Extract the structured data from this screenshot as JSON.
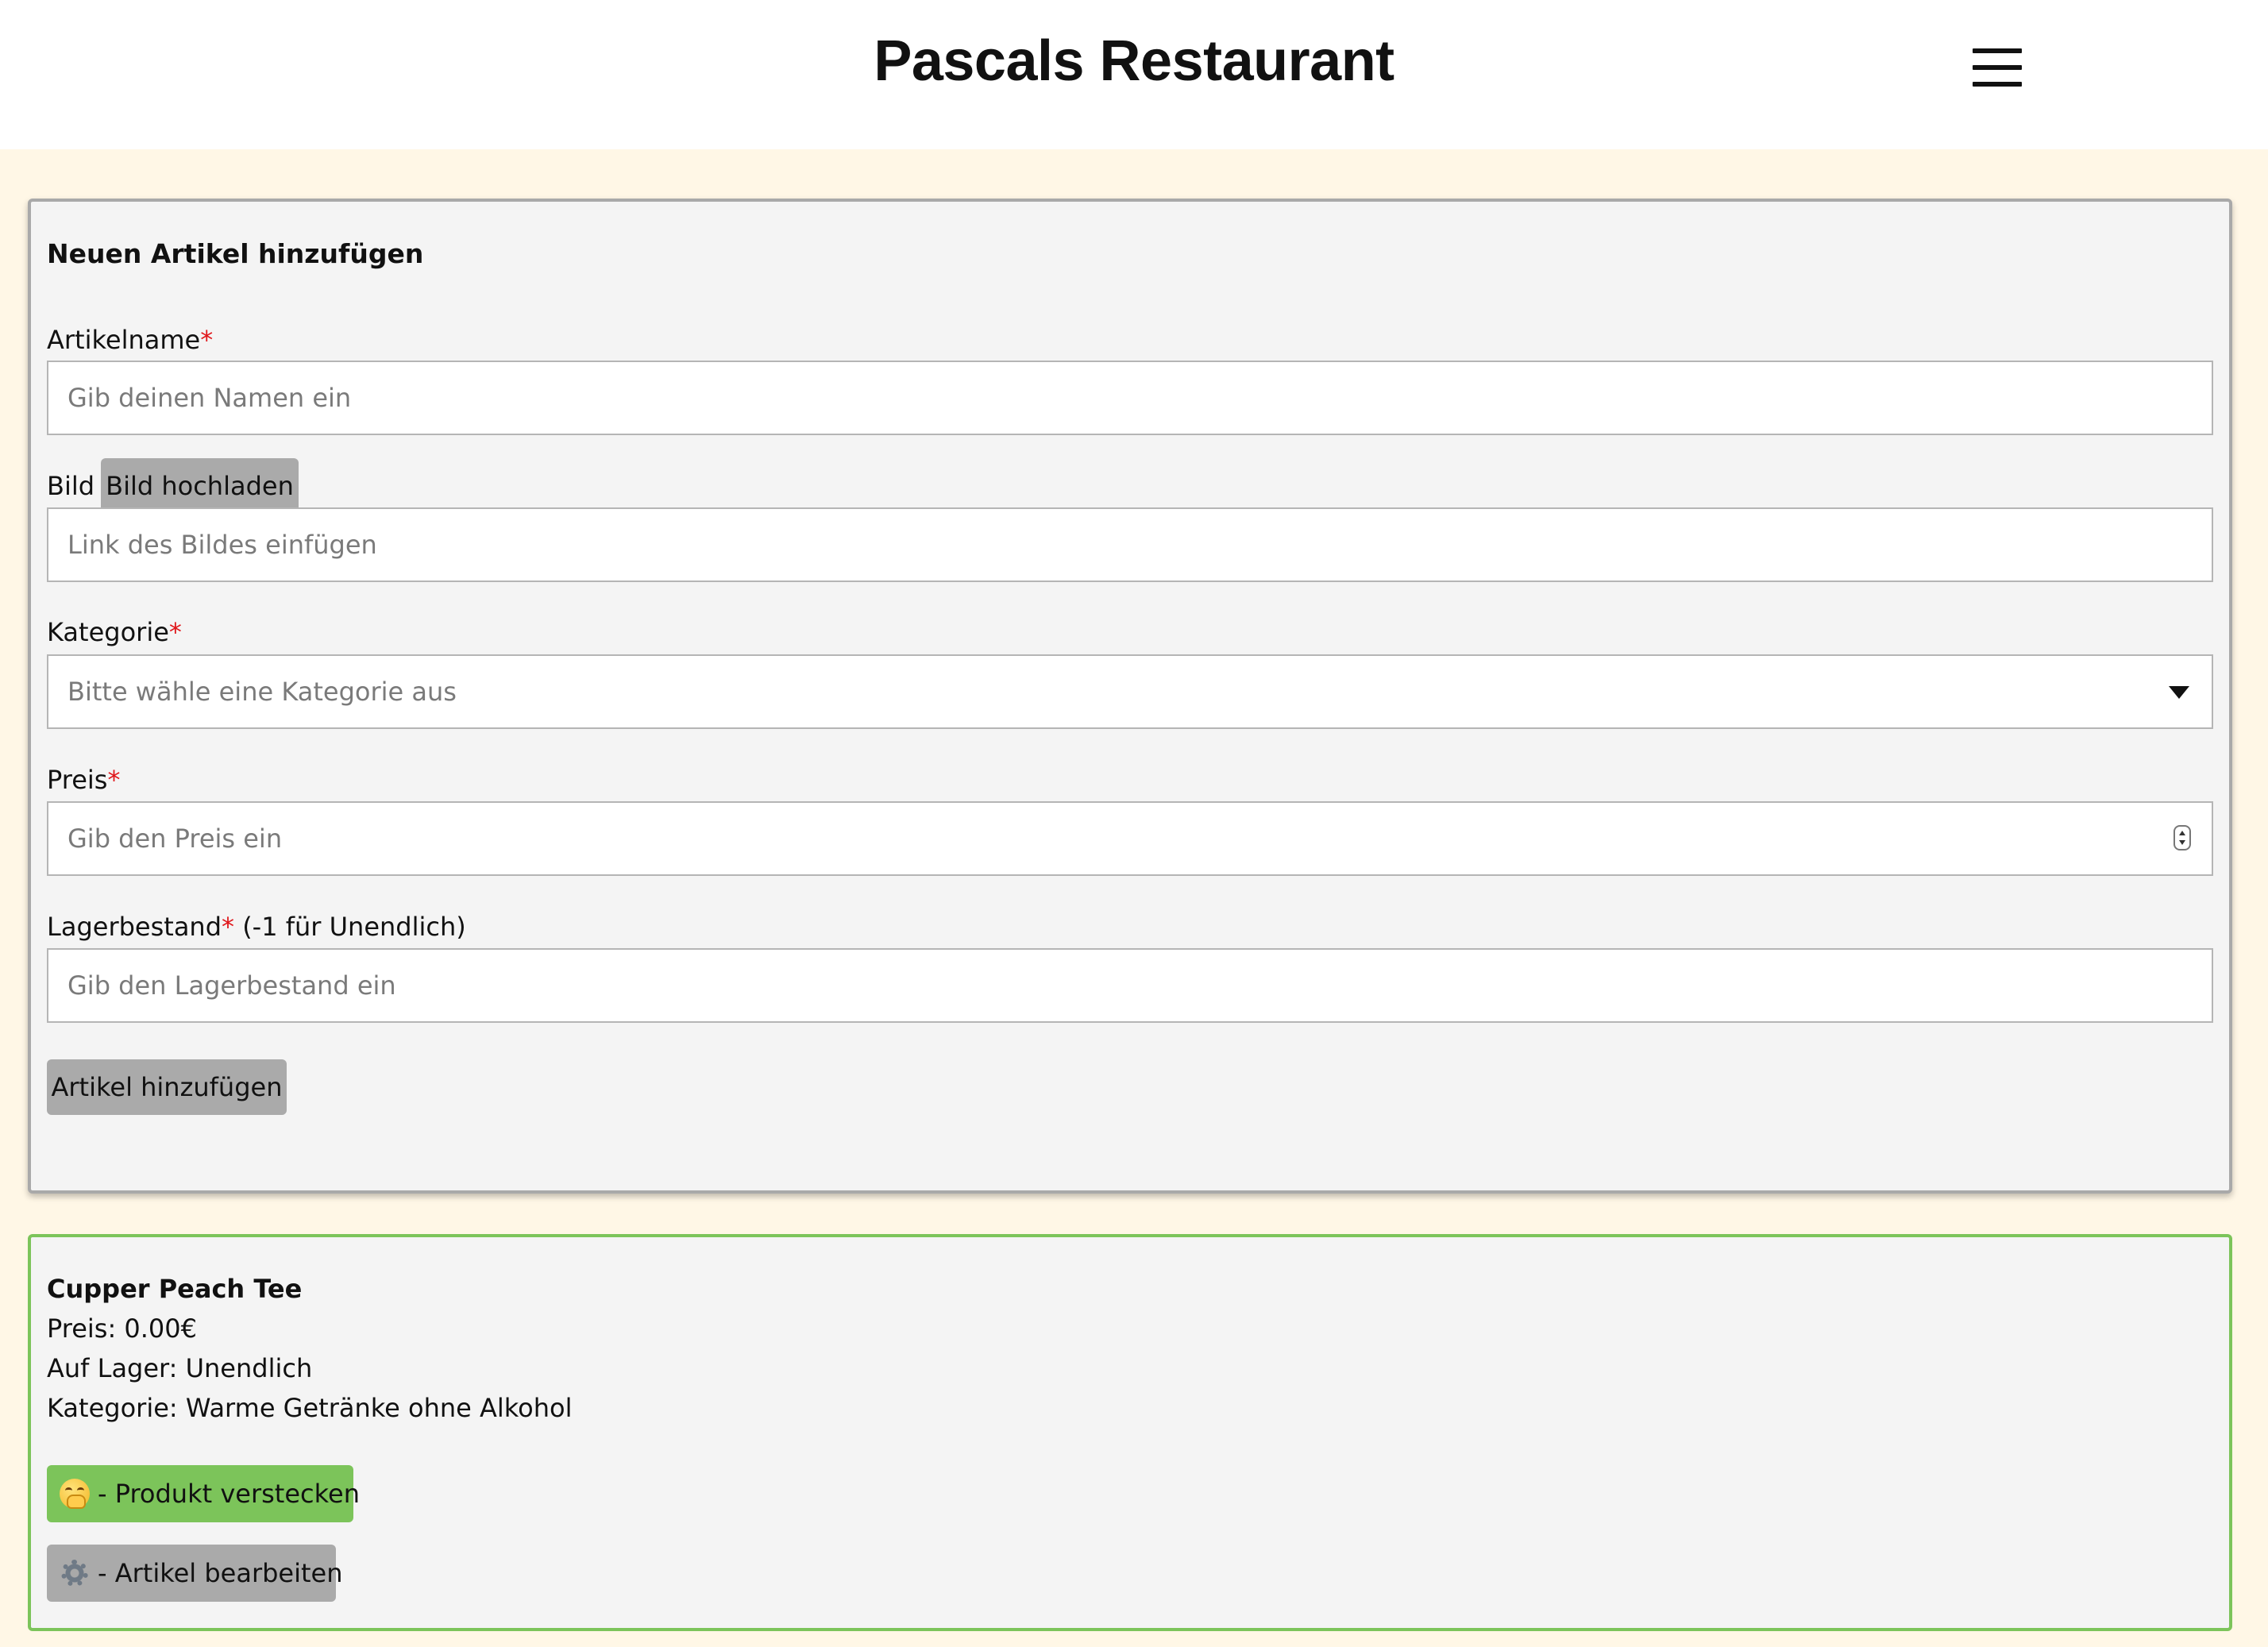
{
  "header": {
    "title": "Pascals Restaurant",
    "menu_icon": "hamburger-menu-icon"
  },
  "form": {
    "title": "Neuen Artikel hinzufügen",
    "name": {
      "label": "Artikelname",
      "required_marker": "*",
      "placeholder": "Gib deinen Namen ein",
      "value": ""
    },
    "image": {
      "label": "Bild",
      "upload_button": "Bild hochladen",
      "placeholder": "Link des Bildes einfügen",
      "value": ""
    },
    "category": {
      "label": "Kategorie",
      "required_marker": "*",
      "selected": "Bitte wähle eine Kategorie aus"
    },
    "price": {
      "label": "Preis",
      "required_marker": "*",
      "placeholder": "Gib den Preis ein",
      "value": ""
    },
    "stock": {
      "label": "Lagerbestand",
      "required_marker": "*",
      "hint": " (-1 für Unendlich)",
      "placeholder": "Gib den Lagerbestand ein",
      "value": ""
    },
    "submit_button": "Artikel hinzufügen"
  },
  "item": {
    "name": "Cupper Peach Tee",
    "price": "Preis: 0.00€",
    "stock": "Auf Lager: Unendlich",
    "category": "Kategorie: Warme Getränke ohne Alkohol",
    "hide_button": {
      "icon": "face-with-hand-over-mouth-icon",
      "label": "- Produkt verstecken",
      "color": "#7cc45a"
    },
    "edit_button": {
      "icon": "gear-icon",
      "label": "- Artikel bearbeiten",
      "color": "#aaaaaa"
    },
    "border_color": "#7cc45a"
  },
  "colors": {
    "page_background": "#fff7e6",
    "card_background": "#f4f4f4",
    "required": "#e0171b"
  }
}
